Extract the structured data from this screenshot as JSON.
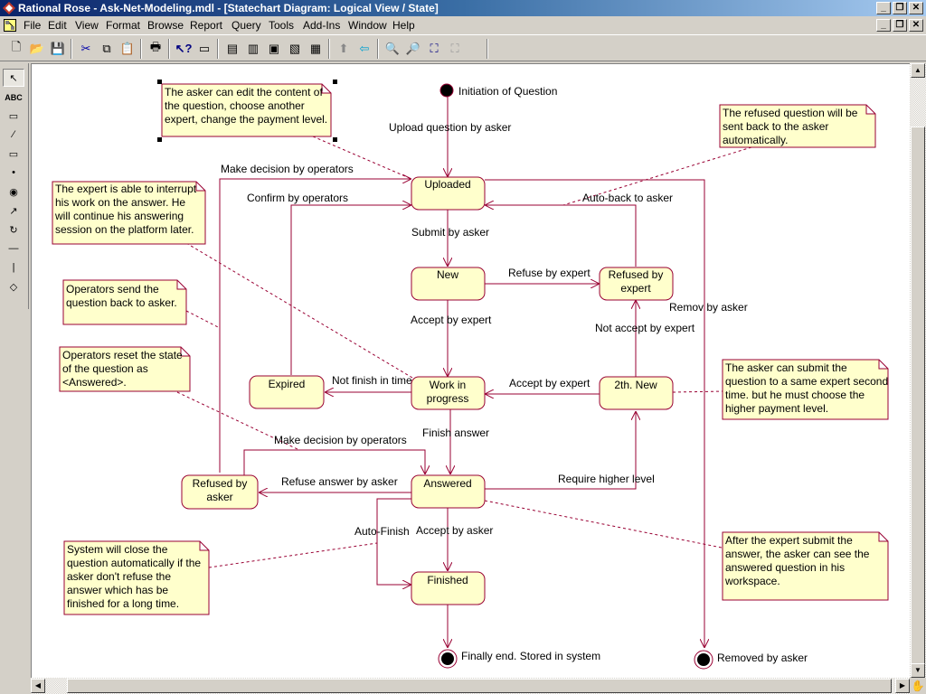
{
  "window": {
    "title": "Rational Rose - Ask-Net-Modeling.mdl - [Statechart Diagram: Logical View / State]",
    "controls": [
      "minimize",
      "restore",
      "close"
    ]
  },
  "menubar": {
    "items": [
      {
        "label": "File",
        "accel": "F"
      },
      {
        "label": "Edit",
        "accel": "E"
      },
      {
        "label": "View",
        "accel": "V"
      },
      {
        "label": "Format",
        "accel": "o"
      },
      {
        "label": "Browse",
        "accel": "B"
      },
      {
        "label": "Report",
        "accel": "R"
      },
      {
        "label": "Query",
        "accel": "Q"
      },
      {
        "label": "Tools",
        "accel": "T"
      },
      {
        "label": "Add-Ins",
        "accel": "A"
      },
      {
        "label": "Window",
        "accel": "W"
      },
      {
        "label": "Help",
        "accel": "H"
      }
    ]
  },
  "toolbar": {
    "buttons": [
      "new",
      "open",
      "save",
      "cut",
      "copy",
      "paste",
      "print",
      "context-help",
      "view-doc",
      "browse-class-diagram",
      "browse-interaction-diagram",
      "browse-component-diagram",
      "browse-deployment-diagram",
      "browse-parent",
      "browse-previous",
      "zoom-in",
      "zoom-out",
      "fit-in-window",
      "undo-fit"
    ]
  },
  "palette": {
    "tools": [
      {
        "name": "selection",
        "glyph": "↖"
      },
      {
        "name": "text",
        "glyph": "ABC"
      },
      {
        "name": "note",
        "glyph": "▭"
      },
      {
        "name": "anchor-note",
        "glyph": "⁄"
      },
      {
        "name": "state",
        "glyph": "▭"
      },
      {
        "name": "start-state",
        "glyph": "•"
      },
      {
        "name": "end-state",
        "glyph": "◉"
      },
      {
        "name": "transition",
        "glyph": "↗"
      },
      {
        "name": "self-transition",
        "glyph": "↻"
      },
      {
        "name": "horizontal-sync",
        "glyph": "—"
      },
      {
        "name": "vertical-sync",
        "glyph": "|"
      },
      {
        "name": "decision",
        "glyph": "◇"
      }
    ]
  },
  "diagram": {
    "colors": {
      "line": "#990033",
      "fill": "#ffffcc"
    },
    "start": {
      "label": "Initiation of Question"
    },
    "states": {
      "uploaded": "Uploaded",
      "new": "New",
      "refused_expert": [
        "Refused by",
        "expert"
      ],
      "work": [
        "Work in",
        "progress"
      ],
      "expired": "Expired",
      "second_new": "2th. New",
      "answered": "Answered",
      "refused_asker": [
        "Refused by",
        "asker"
      ],
      "finished": "Finished"
    },
    "ends": {
      "final": "Finally end. Stored in system",
      "removed": "Removed by asker"
    },
    "transitions": {
      "upload": "Upload question by asker",
      "make_decision_top": "Make decision by operators",
      "confirm": "Confirm by operators",
      "auto_back": "Auto-back to asker",
      "submit": "Submit by asker",
      "refuse_expert": "Refuse by expert",
      "remove": "Remov by asker",
      "accept_expert_1": "Accept by expert",
      "not_accept": "Not accept by expert",
      "not_finish": "Not finish in time",
      "accept_expert_2": "Accept by expert",
      "finish_answer": "Finish answer",
      "make_decision_bottom": "Make decision by operators",
      "refuse_answer": "Refuse answer by asker",
      "require_higher": "Require higher level",
      "auto_finish": "Auto-Finish",
      "accept_asker": "Accept by asker"
    },
    "notes": {
      "edit": [
        "The asker can edit the content of",
        "the question, choose another",
        "expert, change the payment level."
      ],
      "refused_back": [
        "The refused question will be",
        "sent back to the asker",
        "automatically."
      ],
      "interrupt": [
        "The expert is able to interrupt",
        "his work on the answer. He",
        "will continue his answering",
        "session on the platform later."
      ],
      "send_back": [
        "Operators send the",
        "question back to asker."
      ],
      "reset": [
        "Operators reset the state",
        "of the question as",
        "<Answered>."
      ],
      "second_time": [
        "The asker can submit the",
        "question to a same expert second",
        "time. but he must choose the",
        "higher payment level."
      ],
      "auto_close": [
        "System will close the",
        "question automatically if the",
        "asker don't refuse the",
        "answer which has be",
        "finished for a long time."
      ],
      "after_submit": [
        "After the expert submit the",
        "answer, the asker can see the",
        "answered question in his",
        "workspace."
      ]
    }
  }
}
